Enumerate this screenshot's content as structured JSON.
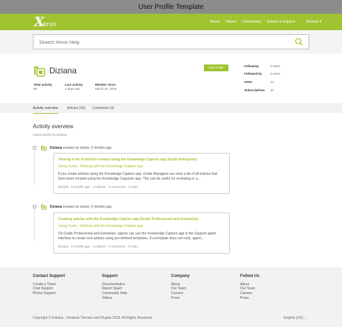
{
  "template_title": "User Profile Template",
  "brand": {
    "logo_x": "X",
    "logo_rest": "eron",
    "accent": "#a1c332"
  },
  "nav": {
    "items": [
      "Home",
      "Videos",
      "Community",
      "Submit a request"
    ],
    "user": "Diziana ▾"
  },
  "search": {
    "placeholder": "Search Xeron Help",
    "icon": "search-icon"
  },
  "profile": {
    "name": "Diziana",
    "edit_label": "Edit profile",
    "stats": [
      {
        "label": "Total activity",
        "value": "86"
      },
      {
        "label": "Last activity",
        "value": "3 days ago"
      },
      {
        "label": "Member since",
        "value": "March 26, 2018"
      }
    ],
    "right_stats": [
      {
        "label": "Following",
        "value": "0 users"
      },
      {
        "label": "Followed by",
        "value": "0 users"
      },
      {
        "label": "Votes",
        "value": "14"
      },
      {
        "label": "Subscriptions",
        "value": "43"
      }
    ]
  },
  "tabs": [
    "Activity overview",
    "Articles (26)",
    "Comments (3)"
  ],
  "activity": {
    "heading": "Activity overview",
    "subheading": "Latest activity by Diziana",
    "entries": [
      {
        "user": "Diziana",
        "action": " created an article, 5 months ago",
        "title": "Viewing a list of articles created using the Knowledge Capture app (Guide Enterprise)",
        "breadcrumb_a": "Using Guide",
        "breadcrumb_b": "Working with the Knowledge Capture app",
        "text": "If you create articles using the Knowledge Capture app, Guide Managers can view a list of all articles that have been created using the Knowledge Caputure app. This can be useful for reviewing or a...",
        "meta": "Diziana  ·  5 months ago  ·  1 follower  ·  0 comments  ·  0 votes"
      },
      {
        "user": "Diziana",
        "action": " created an article, 5 months ago",
        "title": "Creating articles with the Knowledge Capture app (Guide Professional and Enterprise)",
        "breadcrumb_a": "Using Guide",
        "breadcrumb_b": "Working with the Knowledge Capture app",
        "text": "On Guide Professional and Enterprise, agents can use the Knowledge Capture app in the Support agent interface to create new articles using pre-defined templates. If a template does not exist, agent...",
        "meta": "Diziana  ·  5 months ago  ·  1 follower  ·  0 comments  ·  0 votes"
      }
    ]
  },
  "footer": {
    "columns": [
      {
        "heading": "Contact Support",
        "links": [
          "Create a Ticket",
          "Chat Support",
          "Phone Support"
        ]
      },
      {
        "heading": "Support",
        "links": [
          "Documentation",
          "Report Spam",
          "Community Help",
          "Videos"
        ]
      },
      {
        "heading": "Company",
        "links": [
          "About",
          "Our Team",
          "Careers",
          "Press"
        ]
      },
      {
        "heading": "Follow Us",
        "links": [
          "About",
          "Our Team",
          "Careers",
          "Press"
        ]
      }
    ],
    "copyright": "Copyright © Diziana - Zendesk Themes and Plugins 2019. All Rights Reserved.",
    "language": "English (US)  ⌄"
  }
}
